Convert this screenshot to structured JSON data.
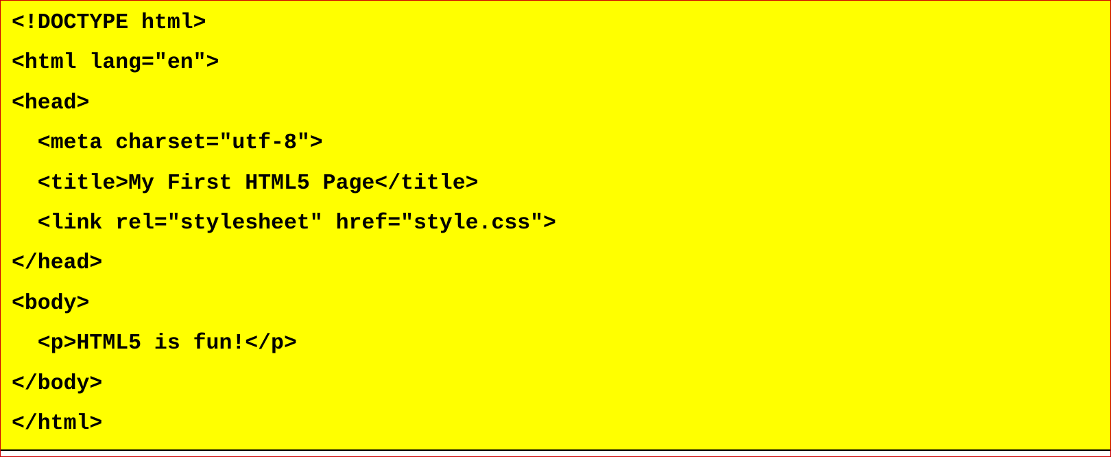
{
  "colors": {
    "panel_background": "#ffff00",
    "text": "#000000",
    "frame_border": "#cc0000",
    "bottom_rule": "#000000"
  },
  "code": {
    "lines": [
      "<!DOCTYPE html>",
      "<html lang=\"en\">",
      "<head>",
      "  <meta charset=\"utf-8\">",
      "  <title>My First HTML5 Page</title>",
      "  <link rel=\"stylesheet\" href=\"style.css\">",
      "</head>",
      "<body>",
      "  <p>HTML5 is fun!</p>",
      "</body>",
      "</html>"
    ]
  }
}
